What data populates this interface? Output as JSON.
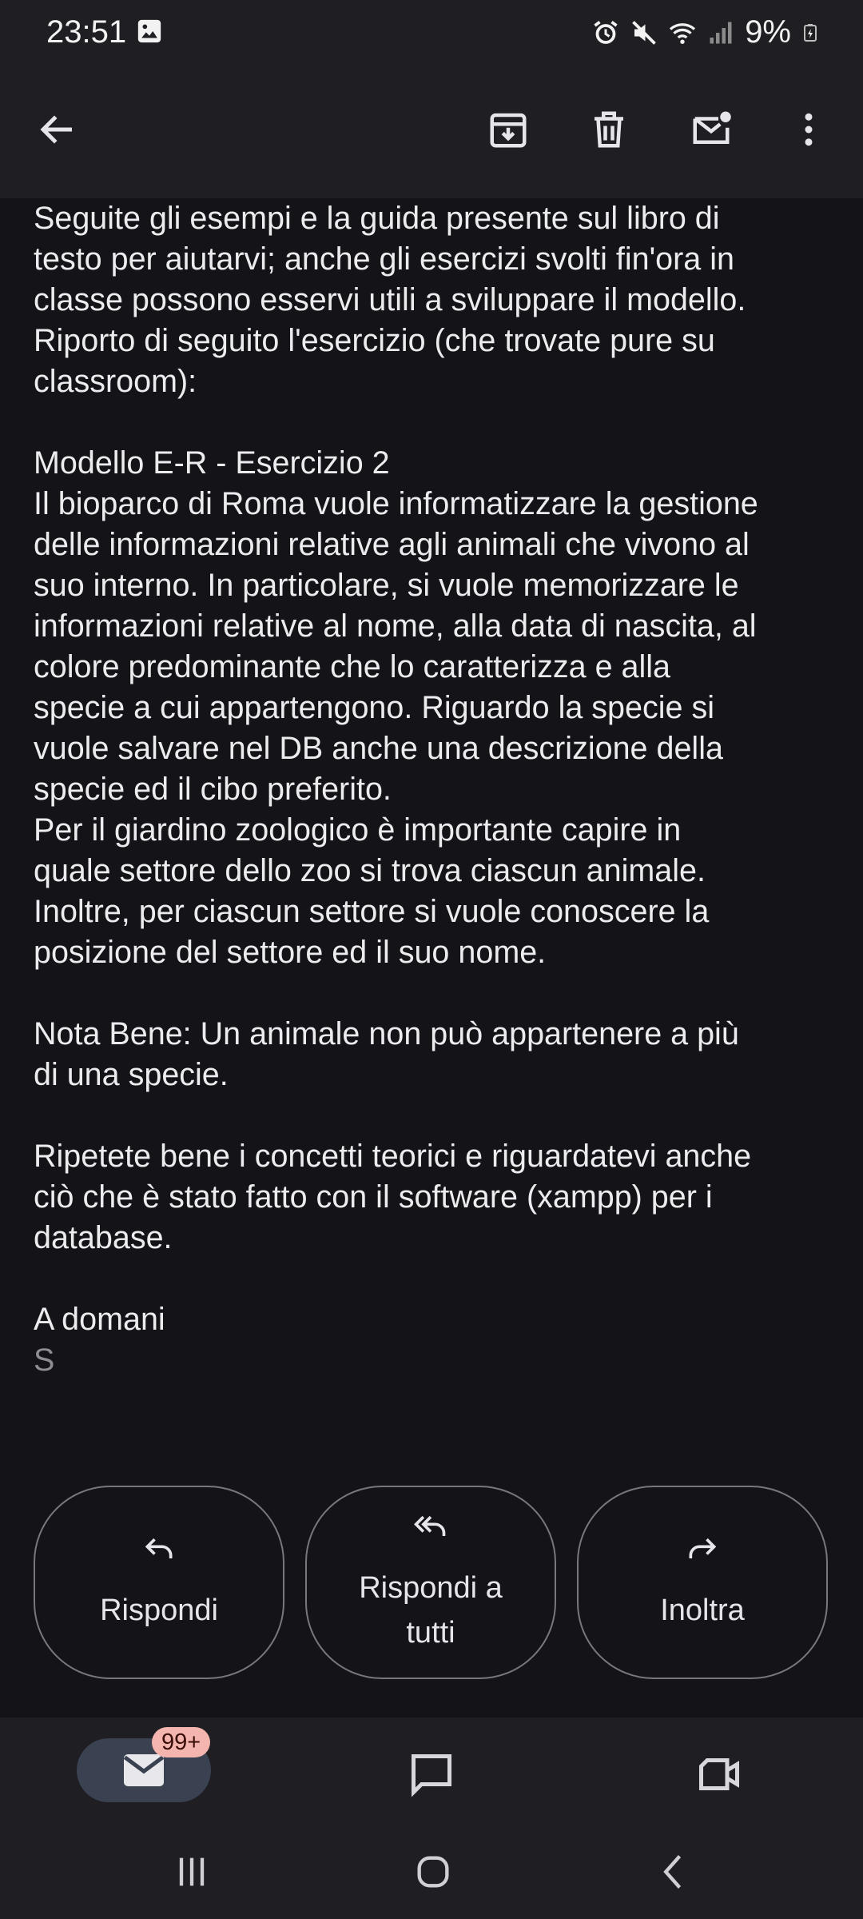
{
  "status_bar": {
    "time": "23:51",
    "battery": "9%",
    "icons": [
      "photo-icon",
      "alarm-icon",
      "mute-icon",
      "wifi-icon",
      "signal-icon",
      "battery-icon"
    ]
  },
  "app_bar": {
    "icons": [
      "back-arrow-icon",
      "archive-icon",
      "delete-icon",
      "mark-unread-icon",
      "more-vert-icon"
    ]
  },
  "email": {
    "paragraphs": [
      "Seguite gli esempi e la guida presente sul libro di\ntesto per aiutarvi; anche gli esercizi svolti fin'ora in\nclasse possono esservi utili a sviluppare il modello.\nRiporto di seguito l'esercizio (che trovate pure su\nclassroom):",
      "Modello E-R - Esercizio 2\nIl bioparco di Roma vuole informatizzare la gestione\ndelle informazioni relative agli animali che vivono al\nsuo interno. In particolare, si vuole memorizzare le\ninformazioni relative al nome, alla data di nascita, al\ncolore predominante che lo caratterizza e alla\nspecie a cui appartengono. Riguardo la specie si\nvuole salvare nel DB anche una descrizione della\nspecie ed il cibo preferito.\nPer il giardino zoologico è importante capire in\nquale settore dello zoo si trova ciascun animale.\nInoltre, per ciascun settore si vuole conoscere la\nposizione del settore ed il suo nome.",
      "Nota Bene: Un animale non può appartenere a più\ndi una specie.",
      "Ripetete bene i concetti teorici e riguardatevi anche\nciò che è stato fatto con il software (xampp) per i\ndatabase.",
      "A domani"
    ],
    "signature": "S"
  },
  "actions": {
    "reply": "Rispondi",
    "reply_all_line1": "Rispondi a",
    "reply_all_line2": "tutti",
    "forward": "Inoltra"
  },
  "bottom_nav": {
    "mail_badge": "99+",
    "items": [
      "mail-icon",
      "chat-icon",
      "meet-icon"
    ]
  },
  "colors": {
    "background": "#141418",
    "bars": "#1f1f23",
    "badge": "#f3b5ad",
    "active_pill": "#3a4150"
  }
}
